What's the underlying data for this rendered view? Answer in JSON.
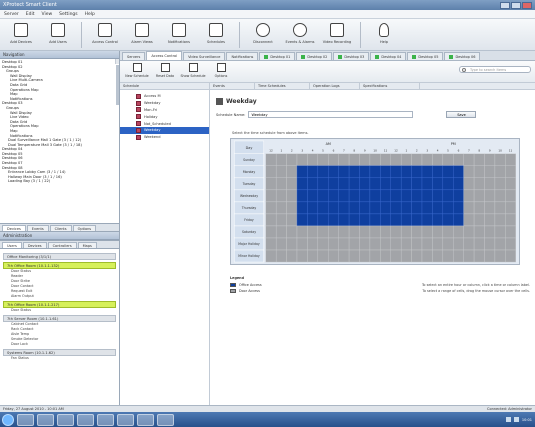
{
  "window": {
    "title": "XProtect Smart Client"
  },
  "menu": [
    "Server",
    "Edit",
    "View",
    "Settings",
    "Help"
  ],
  "toolbar": {
    "buttons": [
      "Add Devices",
      "Add Users",
      "Access Control",
      "Alarm Views",
      "Notifications",
      "Schedules",
      "Disconnect",
      "Events & Alarms",
      "Video Recording",
      "Help"
    ]
  },
  "tabs": [
    {
      "label": "Servers",
      "active": false
    },
    {
      "label": "Access Control",
      "active": true
    },
    {
      "label": "Video Surveillance",
      "active": false
    },
    {
      "label": "Notifications",
      "active": false
    },
    {
      "label": "Desktop 01",
      "active": false
    },
    {
      "label": "Desktop 02",
      "active": false
    },
    {
      "label": "Desktop 03",
      "active": false
    },
    {
      "label": "Desktop 04",
      "active": false
    },
    {
      "label": "Desktop 05",
      "active": false
    },
    {
      "label": "Desktop 06",
      "active": false
    }
  ],
  "left_panel": {
    "header": "Navigation",
    "tree": [
      "Desktop 01",
      "Desktop 02",
      "Groups",
      "Wall Display",
      "Live Multi-Camera",
      "Data Grid",
      "Operations Map",
      "Map",
      "Notifications",
      "Desktop 03",
      "Groups",
      "Wall Display",
      "Live Video",
      "Data Grid",
      "Operations Map",
      "Map",
      "Notifications",
      "Dual Surveillance Mall 1 Gate (3 / 1 / 12)",
      "Dual Temperature Mall 3 Gate (3 / 1 / 18)",
      "Desktop 04",
      "Desktop 05",
      "Desktop 06",
      "Desktop 07",
      "Desktop 08",
      "Entrance Lobby Cam (3 / 1 / 14)",
      "Hallway Main Door (3 / 1 / 16)",
      "Loading Bay (3 / 1 / 22)"
    ],
    "section_tabs": [
      "Devices",
      "Events",
      "Clients",
      "Options"
    ],
    "section_header": "Administration",
    "sub_tabs": [
      "Users",
      "Devices",
      "Controllers",
      "Maps"
    ],
    "groups": [
      {
        "name": "Office Monitoring (3/1/1)",
        "style": "grey",
        "rows": []
      },
      {
        "name": "7th Office Room (10.1.1.132)",
        "style": "green",
        "rows": [
          "Door Status",
          "Reader",
          "Door Strike",
          "Door Contact",
          "Request Exit",
          "Alarm Output"
        ]
      },
      {
        "name": "7th Office Room (10.1.1.217)",
        "style": "green",
        "rows": [
          "Door Status"
        ]
      },
      {
        "name": "7th Server Room (10.1.1.61)",
        "style": "grey",
        "rows": [
          "Cabinet Contact",
          "Rack Contact",
          "Aisle Temp",
          "Smoke Detector",
          "Door Lock"
        ]
      },
      {
        "name": "Systems Room (10.1.1.62)",
        "style": "grey",
        "rows": [
          "Fan Status"
        ]
      }
    ]
  },
  "subtoolbar": {
    "buttons": [
      "New Schedule",
      "Reset Data",
      "Show Schedule",
      "Options"
    ],
    "search_placeholder": "Type to search items"
  },
  "columns": [
    "Schedule",
    "Events",
    "Time Schedules",
    "Operation Logs",
    "Specifications"
  ],
  "schedules": {
    "items": [
      "Access M",
      "Weekday",
      "Mon-Fri",
      "Holiday",
      "Not_Scheduled",
      "Weekday",
      "Weekend"
    ],
    "selected_index": 5
  },
  "detail": {
    "title": "Weekday",
    "name_label": "Schedule Name:",
    "name_value": "Weekday",
    "save_label": "Save",
    "hint": "Select the time schedule from above items.",
    "grid": {
      "day_header": "Day",
      "am_label": "AM",
      "pm_label": "PM",
      "hours": [
        "12",
        "1",
        "2",
        "3",
        "4",
        "5",
        "6",
        "7",
        "8",
        "9",
        "10",
        "11",
        "12",
        "1",
        "2",
        "3",
        "4",
        "5",
        "6",
        "7",
        "8",
        "9",
        "10",
        "11"
      ],
      "days": [
        "Sunday",
        "Monday",
        "Tuesday",
        "Wednesday",
        "Thursday",
        "Friday",
        "Saturday",
        "Major Holiday",
        "Minor Holiday"
      ],
      "on_color": "#0f3f9f",
      "off_color": "#a2a4a8",
      "on_from_hour_index": 3,
      "on_to_hour_index": 18,
      "on_rows": [
        "Monday",
        "Tuesday",
        "Wednesday",
        "Thursday",
        "Friday"
      ]
    },
    "legend": {
      "title": "Legend",
      "items": [
        {
          "label": "Office Access",
          "color": "#0f3f9f",
          "tip": "To select an entire hour or column, click a time or column label."
        },
        {
          "label": "Door Access",
          "color": "#a2a4a8",
          "tip": "To select a range of cells, drag the mouse cursor over the cells."
        }
      ]
    }
  },
  "status": {
    "left": "Friday, 27 August 2010 - 10:01 AM",
    "right": "Connected: Administrator"
  },
  "tray": {
    "time": "10:01"
  }
}
